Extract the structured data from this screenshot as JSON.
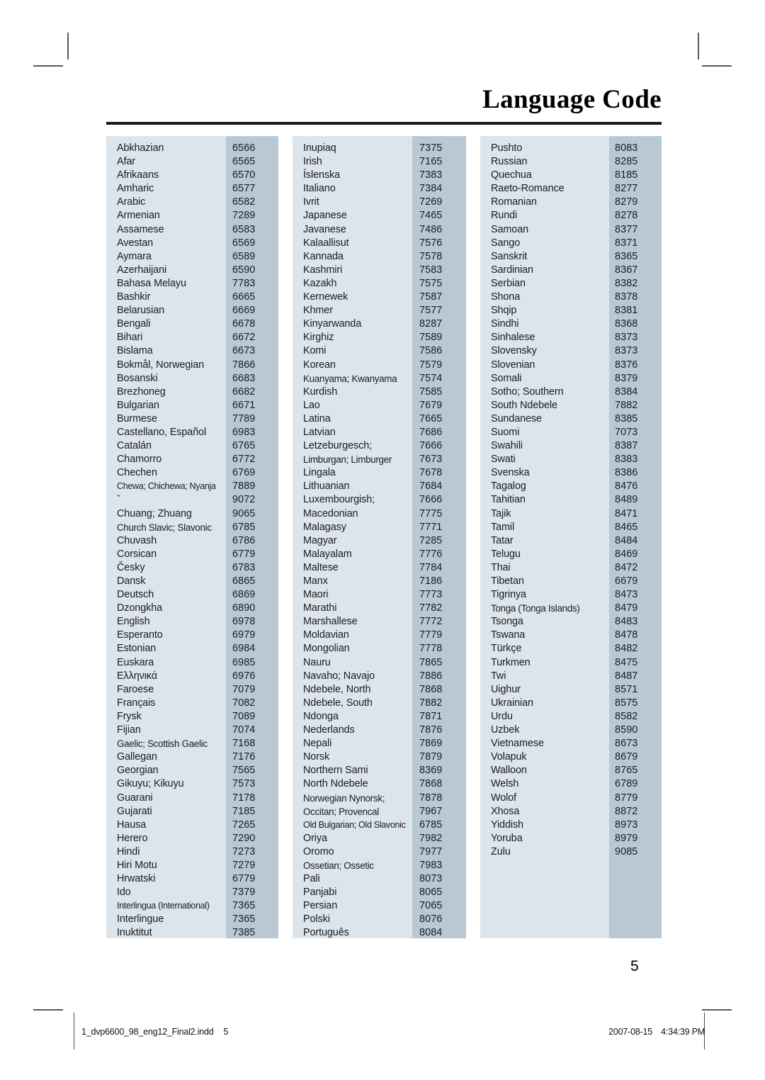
{
  "document": {
    "title": "Language Code",
    "page_number": "5"
  },
  "footer": {
    "filename": "1_dvp6600_98_eng12_Final2.indd",
    "page_label": "5",
    "date": "2007-08-15",
    "time": "4:34:39 PM"
  },
  "colors": {
    "name_panel": "#dce5ec",
    "code_panel": "#b8c9d5",
    "rule": "#1a1a1a",
    "text": "#1b1b1b",
    "crop_mark": "#5a5a5f"
  },
  "columns": [
    {
      "id": "column-1",
      "rows": [
        {
          "name": "Abkhazian",
          "code": "6566"
        },
        {
          "name": "Afar",
          "code": "6565"
        },
        {
          "name": "Afrikaans",
          "code": "6570"
        },
        {
          "name": "Amharic",
          "code": "6577"
        },
        {
          "name": "Arabic",
          "code": "6582"
        },
        {
          "name": "Armenian",
          "code": "7289"
        },
        {
          "name": "Assamese",
          "code": "6583"
        },
        {
          "name": "Avestan",
          "code": "6569"
        },
        {
          "name": "Aymara",
          "code": "6589"
        },
        {
          "name": "Azerhaijani",
          "code": "6590"
        },
        {
          "name": "Bahasa Melayu",
          "code": "7783"
        },
        {
          "name": "Bashkir",
          "code": "6665"
        },
        {
          "name": "Belarusian",
          "code": "6669"
        },
        {
          "name": "Bengali",
          "code": "6678"
        },
        {
          "name": "Bihari",
          "code": "6672"
        },
        {
          "name": "Bislama",
          "code": "6673"
        },
        {
          "name": "Bokmål, Norwegian",
          "code": "7866"
        },
        {
          "name": "Bosanski",
          "code": "6683"
        },
        {
          "name": "Brezhoneg",
          "code": "6682"
        },
        {
          "name": "Bulgarian",
          "code": "6671"
        },
        {
          "name": "Burmese",
          "code": "7789"
        },
        {
          "name": "Castellano, Español",
          "code": "6983"
        },
        {
          "name": "Catalán",
          "code": "6765"
        },
        {
          "name": "Chamorro",
          "code": "6772"
        },
        {
          "name": "Chechen",
          "code": "6769"
        },
        {
          "name": "Chewa; Chichewa; Nyanja",
          "code": "7889",
          "squeeze": true
        },
        {
          "name": "ˇ",
          "code": "9072"
        },
        {
          "name": "Chuang; Zhuang",
          "code": "9065"
        },
        {
          "name": "Church Slavic; Slavonic",
          "code": "6785",
          "squeeze2": true
        },
        {
          "name": "Chuvash",
          "code": "6786"
        },
        {
          "name": "Corsican",
          "code": "6779"
        },
        {
          "name": "Česky",
          "code": "6783"
        },
        {
          "name": "Dansk",
          "code": "6865"
        },
        {
          "name": "Deutsch",
          "code": "6869"
        },
        {
          "name": "Dzongkha",
          "code": "6890"
        },
        {
          "name": "English",
          "code": "6978"
        },
        {
          "name": "Esperanto",
          "code": "6979"
        },
        {
          "name": "Estonian",
          "code": "6984"
        },
        {
          "name": "Euskara",
          "code": "6985"
        },
        {
          "name": "Ελληνικά",
          "code": "6976"
        },
        {
          "name": "Faroese",
          "code": "7079"
        },
        {
          "name": "Français",
          "code": "7082"
        },
        {
          "name": "Frysk",
          "code": "7089"
        },
        {
          "name": "Fijian",
          "code": "7074"
        },
        {
          "name": "Gaelic; Scottish Gaelic",
          "code": "7168",
          "squeeze2": true
        },
        {
          "name": "Gallegan",
          "code": "7176"
        },
        {
          "name": "Georgian",
          "code": "7565"
        },
        {
          "name": "Gikuyu; Kikuyu",
          "code": "7573"
        },
        {
          "name": "Guarani",
          "code": "7178"
        },
        {
          "name": "Gujarati",
          "code": "7185"
        },
        {
          "name": "Hausa",
          "code": "7265"
        },
        {
          "name": "Herero",
          "code": "7290"
        },
        {
          "name": "Hindi",
          "code": "7273"
        },
        {
          "name": "Hiri Motu",
          "code": "7279"
        },
        {
          "name": "Hrwatski",
          "code": "6779"
        },
        {
          "name": "Ido",
          "code": "7379"
        },
        {
          "name": "Interlingua (International)",
          "code": "7365",
          "squeeze": true
        },
        {
          "name": "Interlingue",
          "code": "7365"
        },
        {
          "name": "Inuktitut",
          "code": "7385"
        }
      ]
    },
    {
      "id": "column-2",
      "rows": [
        {
          "name": "Inupiaq",
          "code": "7375"
        },
        {
          "name": "Irish",
          "code": "7165"
        },
        {
          "name": "Íslenska",
          "code": "7383"
        },
        {
          "name": "Italiano",
          "code": "7384"
        },
        {
          "name": "Ivrit",
          "code": "7269"
        },
        {
          "name": "Japanese",
          "code": "7465"
        },
        {
          "name": "Javanese",
          "code": "7486"
        },
        {
          "name": "Kalaallisut",
          "code": "7576"
        },
        {
          "name": "Kannada",
          "code": "7578"
        },
        {
          "name": "Kashmiri",
          "code": "7583"
        },
        {
          "name": "Kazakh",
          "code": "7575"
        },
        {
          "name": "Kernewek",
          "code": "7587"
        },
        {
          "name": "Khmer",
          "code": "7577"
        },
        {
          "name": "Kinyarwanda",
          "code": "8287"
        },
        {
          "name": "Kirghiz",
          "code": "7589"
        },
        {
          "name": "Komi",
          "code": "7586"
        },
        {
          "name": "Korean",
          "code": "7579"
        },
        {
          "name": "Kuanyama; Kwanyama",
          "code": "7574",
          "squeeze2": true
        },
        {
          "name": "Kurdish",
          "code": "7585"
        },
        {
          "name": "Lao",
          "code": "7679"
        },
        {
          "name": "Latina",
          "code": "7665"
        },
        {
          "name": "Latvian",
          "code": "7686"
        },
        {
          "name": "Letzeburgesch;",
          "code": "7666"
        },
        {
          "name": "Limburgan; Limburger",
          "code": "7673",
          "squeeze2": true
        },
        {
          "name": "Lingala",
          "code": "7678"
        },
        {
          "name": "Lithuanian",
          "code": "7684"
        },
        {
          "name": "Luxembourgish;",
          "code": "7666"
        },
        {
          "name": "Macedonian",
          "code": "7775"
        },
        {
          "name": "Malagasy",
          "code": "7771"
        },
        {
          "name": "Magyar",
          "code": "7285"
        },
        {
          "name": "Malayalam",
          "code": "7776"
        },
        {
          "name": "Maltese",
          "code": "7784"
        },
        {
          "name": "Manx",
          "code": "7186"
        },
        {
          "name": "Maori",
          "code": "7773"
        },
        {
          "name": "Marathi",
          "code": "7782"
        },
        {
          "name": "Marshallese",
          "code": "7772"
        },
        {
          "name": "Moldavian",
          "code": "7779"
        },
        {
          "name": "Mongolian",
          "code": "7778"
        },
        {
          "name": "Nauru",
          "code": "7865"
        },
        {
          "name": "Navaho; Navajo",
          "code": "7886"
        },
        {
          "name": "Ndebele, North",
          "code": "7868"
        },
        {
          "name": "Ndebele, South",
          "code": "7882"
        },
        {
          "name": "Ndonga",
          "code": "7871"
        },
        {
          "name": "Nederlands",
          "code": "7876"
        },
        {
          "name": "Nepali",
          "code": "7869"
        },
        {
          "name": "Norsk",
          "code": "7879"
        },
        {
          "name": "Northern Sami",
          "code": "8369"
        },
        {
          "name": "North Ndebele",
          "code": "7868"
        },
        {
          "name": "Norwegian Nynorsk;",
          "code": "7878",
          "squeeze2": true
        },
        {
          "name": "Occitan; Provencal",
          "code": "7967",
          "squeeze2": true
        },
        {
          "name": "Old Bulgarian; Old Slavonic",
          "code": "6785",
          "squeeze": true
        },
        {
          "name": "Oriya",
          "code": "7982"
        },
        {
          "name": "Oromo",
          "code": "7977"
        },
        {
          "name": "Ossetian; Ossetic",
          "code": "7983",
          "squeeze2": true
        },
        {
          "name": "Pali",
          "code": "8073"
        },
        {
          "name": "Panjabi",
          "code": "8065"
        },
        {
          "name": "Persian",
          "code": "7065"
        },
        {
          "name": "Polski",
          "code": "8076"
        },
        {
          "name": "Português",
          "code": "8084"
        }
      ]
    },
    {
      "id": "column-3",
      "rows": [
        {
          "name": "Pushto",
          "code": "8083"
        },
        {
          "name": "Russian",
          "code": "8285"
        },
        {
          "name": "Quechua",
          "code": "8185"
        },
        {
          "name": "Raeto-Romance",
          "code": "8277"
        },
        {
          "name": "Romanian",
          "code": "8279"
        },
        {
          "name": "Rundi",
          "code": "8278"
        },
        {
          "name": "Samoan",
          "code": "8377"
        },
        {
          "name": "Sango",
          "code": "8371"
        },
        {
          "name": "Sanskrit",
          "code": "8365"
        },
        {
          "name": "Sardinian",
          "code": "8367"
        },
        {
          "name": "Serbian",
          "code": "8382"
        },
        {
          "name": "Shona",
          "code": "8378"
        },
        {
          "name": "Shqip",
          "code": "8381"
        },
        {
          "name": "Sindhi",
          "code": "8368"
        },
        {
          "name": "Sinhalese",
          "code": "8373"
        },
        {
          "name": "Slovensky",
          "code": "8373"
        },
        {
          "name": "Slovenian",
          "code": "8376"
        },
        {
          "name": "Somali",
          "code": "8379"
        },
        {
          "name": "Sotho; Southern",
          "code": "8384"
        },
        {
          "name": "South Ndebele",
          "code": "7882"
        },
        {
          "name": "Sundanese",
          "code": "8385"
        },
        {
          "name": "Suomi",
          "code": "7073"
        },
        {
          "name": "Swahili",
          "code": "8387"
        },
        {
          "name": "Swati",
          "code": "8383"
        },
        {
          "name": "Svenska",
          "code": "8386"
        },
        {
          "name": "Tagalog",
          "code": "8476"
        },
        {
          "name": "Tahitian",
          "code": "8489"
        },
        {
          "name": "Tajik",
          "code": "8471"
        },
        {
          "name": "Tamil",
          "code": "8465"
        },
        {
          "name": "Tatar",
          "code": "8484"
        },
        {
          "name": "Telugu",
          "code": "8469"
        },
        {
          "name": "Thai",
          "code": "8472"
        },
        {
          "name": "Tibetan",
          "code": "6679"
        },
        {
          "name": "Tigrinya",
          "code": "8473"
        },
        {
          "name": "Tonga (Tonga Islands)",
          "code": "8479",
          "squeeze2": true
        },
        {
          "name": "Tsonga",
          "code": "8483"
        },
        {
          "name": "Tswana",
          "code": "8478"
        },
        {
          "name": "Türkçe",
          "code": "8482"
        },
        {
          "name": "Turkmen",
          "code": "8475"
        },
        {
          "name": "Twi",
          "code": "8487"
        },
        {
          "name": "Uighur",
          "code": "8571"
        },
        {
          "name": "Ukrainian",
          "code": "8575"
        },
        {
          "name": "Urdu",
          "code": "8582"
        },
        {
          "name": "Uzbek",
          "code": "8590"
        },
        {
          "name": "Vietnamese",
          "code": "8673"
        },
        {
          "name": "Volapuk",
          "code": "8679"
        },
        {
          "name": "Walloon",
          "code": "8765"
        },
        {
          "name": "Welsh",
          "code": "6789"
        },
        {
          "name": "Wolof",
          "code": "8779"
        },
        {
          "name": "Xhosa",
          "code": "8872"
        },
        {
          "name": "Yiddish",
          "code": "8973"
        },
        {
          "name": "Yoruba",
          "code": "8979"
        },
        {
          "name": "Zulu",
          "code": "9085"
        }
      ]
    }
  ]
}
